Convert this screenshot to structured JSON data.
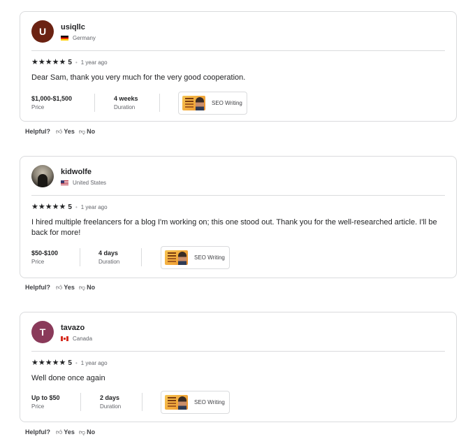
{
  "helpful": {
    "label": "Helpful?",
    "yes": "Yes",
    "no": "No"
  },
  "reviews": [
    {
      "username": "usiqllc",
      "avatar_letter": "U",
      "avatar_color": "#6b2212",
      "country": "Germany",
      "stars": 5,
      "score": "5",
      "time_ago": "1 year ago",
      "text": "Dear Sam, thank you very much for the very good cooperation.",
      "price": "$1,000-$1,500",
      "price_label": "Price",
      "duration": "4 weeks",
      "duration_label": "Duration",
      "gig_title": "SEO Writing"
    },
    {
      "username": "kidwolfe",
      "avatar_letter": "",
      "avatar_color": "#5a544c",
      "country": "United States",
      "stars": 5,
      "score": "5",
      "time_ago": "1 year ago",
      "text": "I hired multiple freelancers for a blog I'm working on; this one stood out. Thank you for the well-researched article. I'll be back for more!",
      "price": "$50-$100",
      "price_label": "Price",
      "duration": "4 days",
      "duration_label": "Duration",
      "gig_title": "SEO Writing"
    },
    {
      "username": "tavazo",
      "avatar_letter": "T",
      "avatar_color": "#8a3a5a",
      "country": "Canada",
      "stars": 5,
      "score": "5",
      "time_ago": "1 year ago",
      "text": "Well done once again",
      "price": "Up to $50",
      "price_label": "Price",
      "duration": "2 days",
      "duration_label": "Duration",
      "gig_title": "SEO Writing"
    }
  ]
}
